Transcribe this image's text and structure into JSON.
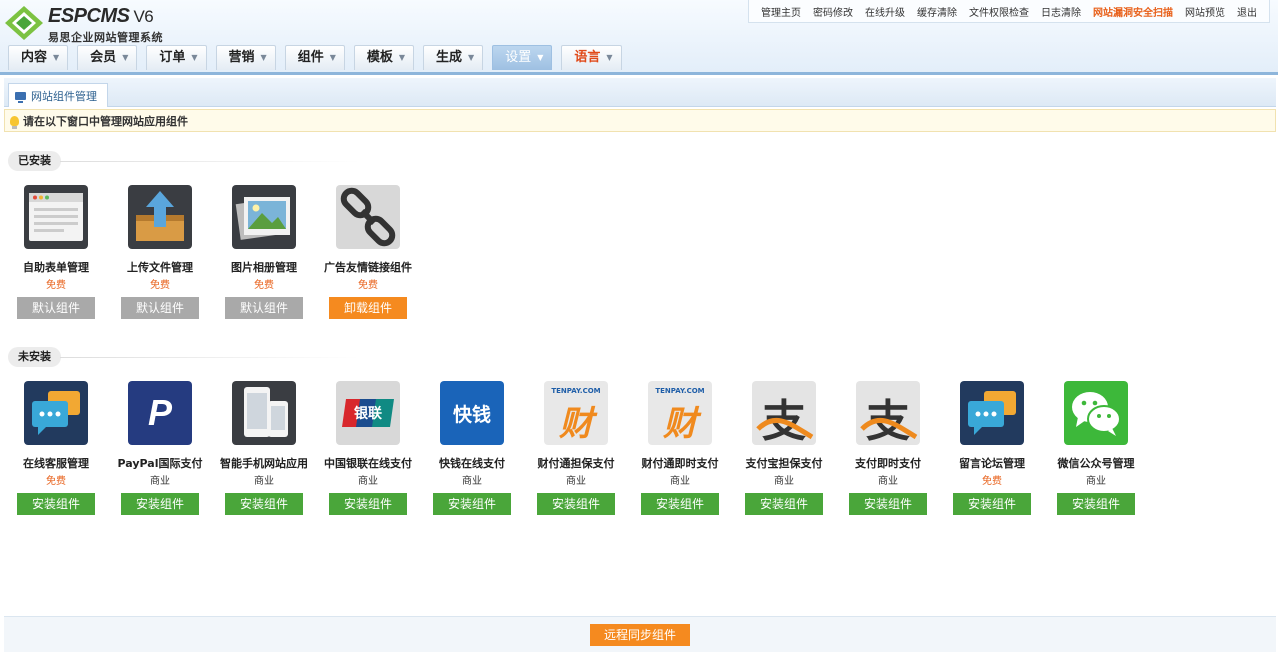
{
  "brand": {
    "name": "ESPCMS",
    "version": "V6",
    "subtitle": "易思企业网站管理系统"
  },
  "toplinks": [
    "管理主页",
    "密码修改",
    "在线升级",
    "缓存清除",
    "文件权限检查",
    "日志清除",
    "网站漏洞安全扫描",
    "网站预览",
    "退出"
  ],
  "nav": [
    "内容",
    "会员",
    "订单",
    "营销",
    "组件",
    "模板",
    "生成",
    "设置",
    "语言"
  ],
  "tab": "网站组件管理",
  "notice": "请在以下窗口中管理网站应用组件",
  "installed_label": "已安装",
  "uninstalled_label": "未安装",
  "installed": [
    {
      "name": "自助表单管理",
      "price": "免费",
      "button": "默认组件",
      "icon": "form-icon"
    },
    {
      "name": "上传文件管理",
      "price": "免费",
      "button": "默认组件",
      "icon": "upload-icon"
    },
    {
      "name": "图片相册管理",
      "price": "免费",
      "button": "默认组件",
      "icon": "album-icon"
    },
    {
      "name": "广告友情链接组件",
      "price": "免费",
      "button": "卸载组件",
      "icon": "link-icon"
    }
  ],
  "uninstalled": [
    {
      "name": "在线客服管理",
      "price": "免费",
      "button": "安装组件",
      "icon": "chat-icon"
    },
    {
      "name": "PayPal国际支付",
      "price": "商业",
      "button": "安装组件",
      "icon": "paypal-icon"
    },
    {
      "name": "智能手机网站应用",
      "price": "商业",
      "button": "安装组件",
      "icon": "mobile-icon"
    },
    {
      "name": "中国银联在线支付",
      "price": "商业",
      "button": "安装组件",
      "icon": "unionpay-icon"
    },
    {
      "name": "快钱在线支付",
      "price": "商业",
      "button": "安装组件",
      "icon": "99bill-icon"
    },
    {
      "name": "财付通担保支付",
      "price": "商业",
      "button": "安装组件",
      "icon": "tenpay-icon"
    },
    {
      "name": "财付通即时支付",
      "price": "商业",
      "button": "安装组件",
      "icon": "tenpay-icon"
    },
    {
      "name": "支付宝担保支付",
      "price": "商业",
      "button": "安装组件",
      "icon": "alipay-icon"
    },
    {
      "name": "支付即时支付",
      "price": "商业",
      "button": "安装组件",
      "icon": "alipay-icon"
    },
    {
      "name": "留言论坛管理",
      "price": "免费",
      "button": "安装组件",
      "icon": "chat-icon"
    },
    {
      "name": "微信公众号管理",
      "price": "商业",
      "button": "安装组件",
      "icon": "wechat-icon"
    }
  ],
  "icon_text": {
    "tenpay_brand": "TENPAY.COM",
    "tenpay_char": "财",
    "unionpay": "银联",
    "kuaiqian": "快钱",
    "paypal": "P",
    "alipay": "支"
  },
  "sync_button": "远程同步组件",
  "colors": {
    "free": "#e8601a",
    "install": "#4aa63a",
    "default": "#a9a9a9",
    "uninstall": "#f58a1f",
    "hot_link": "#e8601a"
  }
}
